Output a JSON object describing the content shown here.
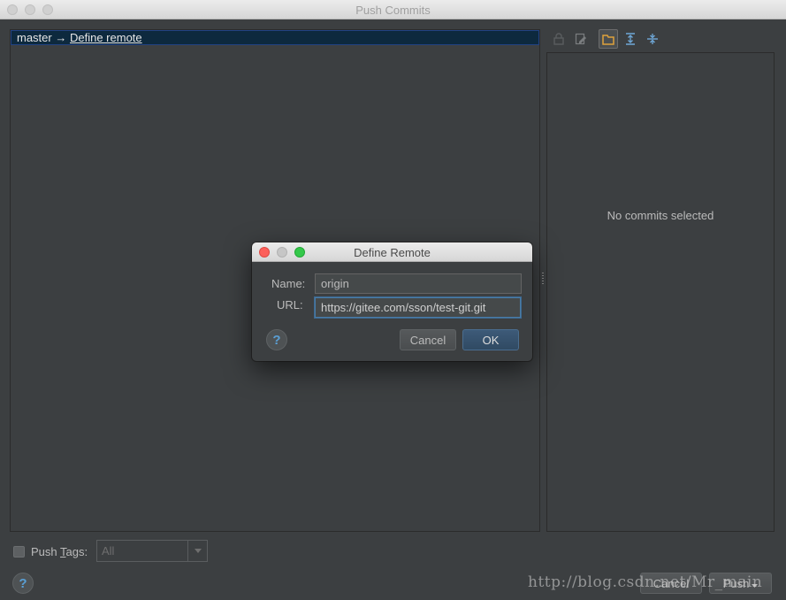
{
  "window": {
    "title": "Push Commits"
  },
  "branch_row": {
    "branch": "master",
    "arrow": "→",
    "link": "Define remote"
  },
  "right_pane": {
    "empty_text": "No commits selected"
  },
  "toolbar": {
    "icons": [
      "lock-icon",
      "edit-icon",
      "folder-icon",
      "expand-all-icon",
      "collapse-all-icon"
    ]
  },
  "bottom": {
    "push_tags_label_before": "Push ",
    "push_tags_mnemonic": "T",
    "push_tags_label_after": "ags:",
    "tags_value": "All",
    "cancel_label": "Cancel",
    "push_label": "Push",
    "help": "?"
  },
  "watermark": "http://blog.csdn.net/Mr_main",
  "dialog": {
    "title": "Define Remote",
    "name_label": "Name:",
    "name_value": "origin",
    "url_label": "URL:",
    "url_value": "https://gitee.com/sson/test-git.git",
    "cancel_label": "Cancel",
    "ok_label": "OK",
    "help": "?"
  },
  "colors": {
    "background": "#3c3f41",
    "selection": "#0d293e",
    "accent": "#4a7ba6",
    "close": "#fc605b",
    "minimize": "#c6c6c6",
    "zoom": "#34c84a"
  }
}
